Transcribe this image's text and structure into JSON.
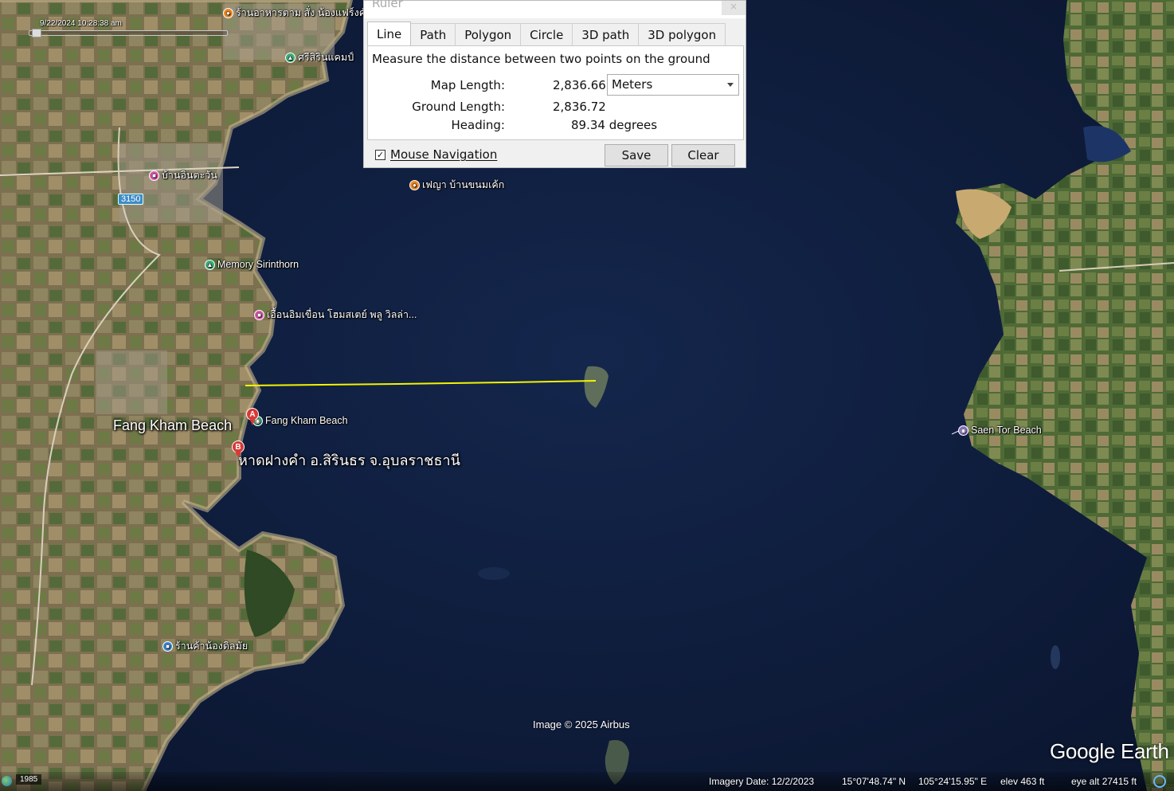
{
  "map": {
    "timestamp": "9/22/2024  10:28:38 am",
    "road_shield": "3150",
    "credit": "Image © 2025 Airbus",
    "brand": "Google Earth",
    "big_labels": {
      "fang_kham_beach": "Fang Kham Beach",
      "thai_beach": "หาดฝางคำ อ.สิรินธร จ.อุบลราชธานี"
    },
    "markers": {
      "a": "A",
      "b": "B"
    },
    "places": [
      {
        "id": "restaurant-top",
        "label": "ร้านอาหารตาม สั่ง น้องแฟร์งค์",
        "pin": "orange",
        "icon": "restaurant-icon"
      },
      {
        "id": "camp-sirin",
        "label": "ศรีสิรินแคมป์",
        "pin": "green",
        "icon": "campground-icon"
      },
      {
        "id": "baan-intawan",
        "label": "บ้านอินตะวัน",
        "pin": "pink",
        "icon": "lodging-icon"
      },
      {
        "id": "phaya-bakery",
        "label": "เฟญา บ้านขนมเค้ก",
        "pin": "orange",
        "icon": "restaurant-icon"
      },
      {
        "id": "memory-sirinthorn",
        "label": "Memory Sirinthorn",
        "pin": "green",
        "icon": "campground-icon"
      },
      {
        "id": "homestay-villa",
        "label": "เอื้อนอิมเขื่อน โฮมสเตย์ พลู วิลล่า...",
        "pin": "pink",
        "icon": "lodging-icon"
      },
      {
        "id": "fang-kham-beach-poi",
        "label": "Fang Kham Beach",
        "pin": "green",
        "icon": "beach-icon"
      },
      {
        "id": "shop-nong",
        "label": "ร้านค้าน้องดิลมัย",
        "pin": "blue",
        "icon": "shopping-icon"
      },
      {
        "id": "saen-tor-beach",
        "label": "Saen Tor Beach",
        "pin": "purple",
        "icon": "beach-icon"
      }
    ]
  },
  "statusbar": {
    "year": "1985",
    "imagery_date": "Imagery Date: 12/2/2023",
    "lat": "15°07'48.74\" N",
    "lon": "105°24'15.95\" E",
    "elev": "elev   463 ft",
    "eye_alt": "eye alt  27415 ft"
  },
  "ruler": {
    "title": "Ruler",
    "close": "×",
    "tabs": [
      "Line",
      "Path",
      "Polygon",
      "Circle",
      "3D path",
      "3D polygon"
    ],
    "active_tab": "Line",
    "description": "Measure the distance between two points on the ground",
    "map_length_label": "Map Length:",
    "map_length_value": "2,836.66",
    "unit": "Meters",
    "ground_length_label": "Ground Length:",
    "ground_length_value": "2,836.72",
    "heading_label": "Heading:",
    "heading_value": "89.34 degrees",
    "mouse_navigation_label": "Mouse Navigation",
    "mouse_navigation_checked": true,
    "save_label": "Save",
    "clear_label": "Clear"
  },
  "colors": {
    "water": "#0f1c3a",
    "land": "#8a7a55",
    "measure_line": "#f4f400"
  }
}
